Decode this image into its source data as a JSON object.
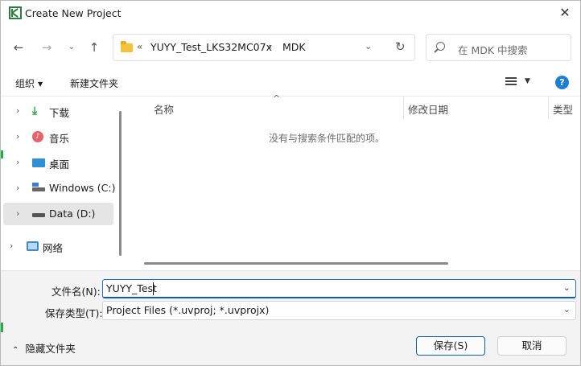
{
  "window": {
    "title": "Create New Project"
  },
  "nav": {
    "breadcrumb_overflow": "«",
    "path": [
      "YUYY_Test_LKS32MC07x",
      "MDK"
    ],
    "search_placeholder": "在 MDK 中搜索"
  },
  "command_bar": {
    "organize": "组织",
    "new_folder": "新建文件夹"
  },
  "tree": {
    "items": [
      {
        "label": "下载",
        "icon": "download-icon"
      },
      {
        "label": "音乐",
        "icon": "music-icon"
      },
      {
        "label": "桌面",
        "icon": "desktop-icon"
      },
      {
        "label": "Windows (C:)",
        "icon": "drive-icon"
      },
      {
        "label": "Data (D:)",
        "icon": "drive-icon",
        "selected": true
      },
      {
        "label": "网络",
        "icon": "network-icon"
      }
    ]
  },
  "file_list": {
    "columns": [
      "名称",
      "修改日期",
      "类型"
    ],
    "empty_message": "没有与搜索条件匹配的项。"
  },
  "form": {
    "filename_label": "文件名(N):",
    "filename_value": "YUYY_Test",
    "filetype_label": "保存类型(T):",
    "filetype_value": "Project Files (*.uvproj; *.uvprojx)"
  },
  "footer": {
    "hide_folders": "隐藏文件夹",
    "save": "保存(S)",
    "cancel": "取消"
  },
  "colors": {
    "accent": "#0a5fb4",
    "selection": "#e5e5e5",
    "panel": "#f3f3f3"
  }
}
